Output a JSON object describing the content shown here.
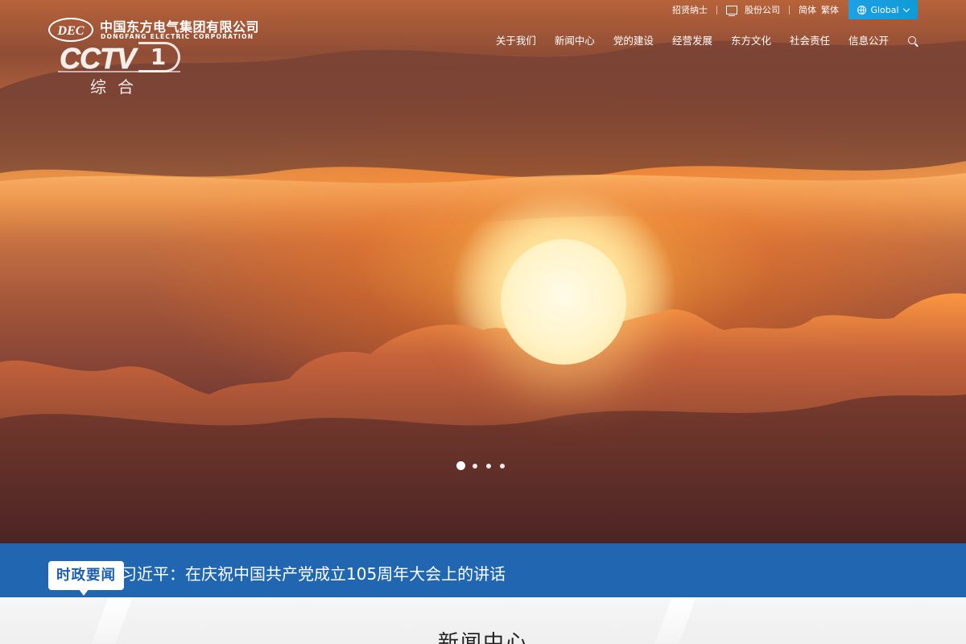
{
  "header": {
    "logo": {
      "badge_text": "DEC",
      "company_cn": "中国东方电气集团有限公司",
      "company_en": "DONGFANG ELECTRIC CORPORATION"
    },
    "watermark": {
      "brand": "CCTV",
      "channel_number": "1",
      "channel_name": "综合"
    },
    "utility": {
      "recruit": "招贤纳士",
      "stock_company": "股份公司",
      "simplified": "简体",
      "traditional": "繁体",
      "global_label": "Global"
    },
    "nav": [
      {
        "label": "关于我们"
      },
      {
        "label": "新闻中心"
      },
      {
        "label": "党的建设"
      },
      {
        "label": "经营发展"
      },
      {
        "label": "东方文化"
      },
      {
        "label": "社会责任"
      },
      {
        "label": "信息公开"
      }
    ]
  },
  "hero": {
    "slide_count": 4,
    "active_slide": 1
  },
  "ticker": {
    "badge": "时政要闻",
    "headline": "习近平：在庆祝中国共产党成立105周年大会上的讲话"
  },
  "section": {
    "title": "新闻中心"
  },
  "colors": {
    "ticker_bg": "#2066b0",
    "global_btn": "#1ea0e6",
    "badge_text": "#1c5fae"
  }
}
